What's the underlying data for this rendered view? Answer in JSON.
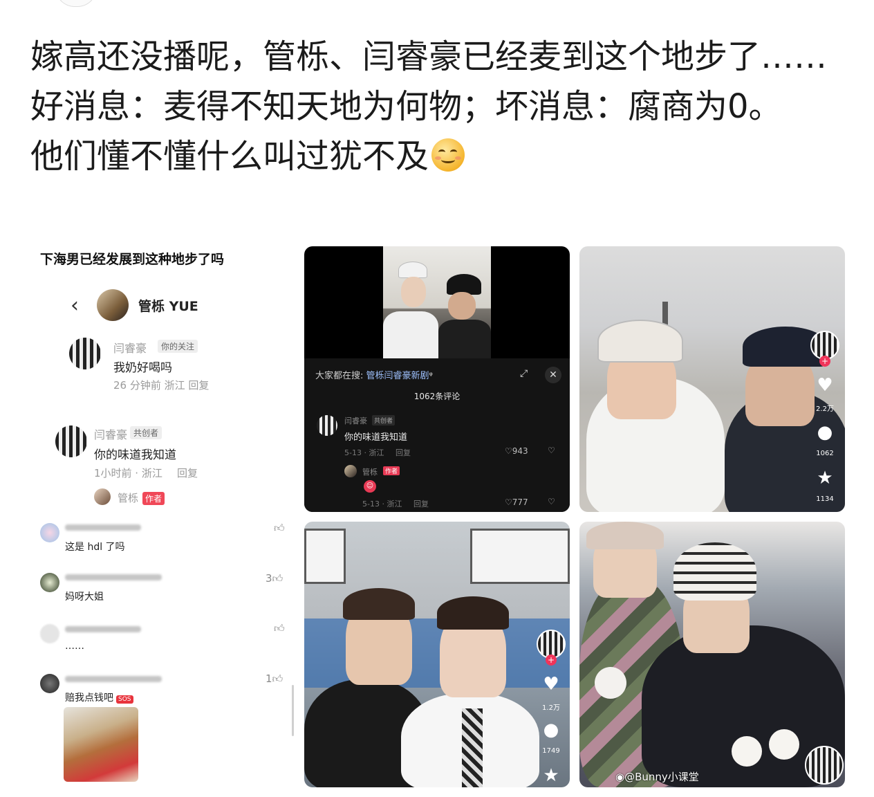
{
  "post": {
    "line1": "嫁高还没播呢，管栎、闫睿豪已经麦到这个地步了……好消息：麦得不知天地为何物；坏消息：腐商为0。",
    "line2": "他们懂不懂什么叫过犹不及"
  },
  "left_screenshot": {
    "title": "下海男已经发展到这种地步了吗",
    "header_name": "管栎 YUE",
    "comments": [
      {
        "name": "闫睿豪",
        "tag": "你的关注",
        "text": "我奶好喝吗",
        "meta": "26 分钟前 浙江 回复"
      },
      {
        "name": "闫睿豪",
        "tag": "共创者",
        "text": "你的味道我知道",
        "meta": "1小时前 · 浙江",
        "reply": "回复"
      }
    ],
    "reply_name": "管栎",
    "reply_tag": "作者",
    "list_comments": [
      {
        "text": "这是 hdl 了吗",
        "likes": ""
      },
      {
        "text": "妈呀大姐",
        "likes": "3"
      },
      {
        "text": "……",
        "likes": ""
      },
      {
        "text": "赔我点钱吧",
        "likes": "1"
      }
    ],
    "sos_badge": "SOS"
  },
  "card_dark": {
    "search_prefix": "大家都在搜: ",
    "search_term": "管栎闫睿豪新剧",
    "comment_count": "1062条评论",
    "commenter": "闫睿豪",
    "commenter_tag": "共创者",
    "comment_text": "你的味道我知道",
    "comment_meta": "5-13 · 浙江",
    "reply_label": "回复",
    "likes": "943",
    "reply_author": "管栎",
    "reply_author_tag": "作者",
    "reply_meta": "5-13 · 浙江",
    "reply_likes": "777"
  },
  "card_snow": {
    "count_1": "2.2万",
    "count_2": "1062",
    "count_3": "1134"
  },
  "card_class": {
    "count_1": "1.2万",
    "count_2": "1749"
  },
  "card_winter": {
    "watermark": "@Bunny小课堂"
  }
}
